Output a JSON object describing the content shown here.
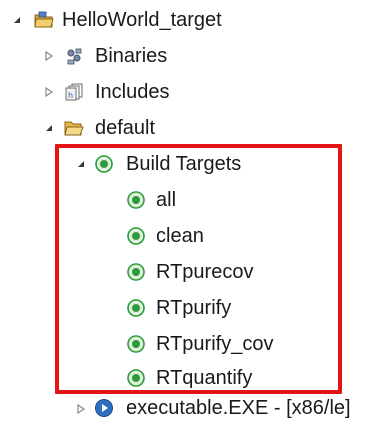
{
  "tree": {
    "project": {
      "label": "HelloWorld_target",
      "expanded": true
    },
    "binaries": {
      "label": "Binaries",
      "expanded": false
    },
    "includes": {
      "label": "Includes",
      "expanded": false
    },
    "default_folder": {
      "label": "default",
      "expanded": true
    },
    "build_targets": {
      "label": "Build Targets",
      "expanded": true,
      "items": [
        "all",
        "clean",
        "RTpurecov",
        "RTpurify",
        "RTpurify_cov",
        "RTquantify"
      ]
    },
    "executable": {
      "label": "executable.EXE - [x86/le]",
      "expanded": false
    }
  },
  "colors": {
    "highlight_border": "#e51414",
    "target_green": "#2e9a3a",
    "folder_yellow": "#e8b54a",
    "exec_blue": "#2f6fbf"
  },
  "icons": {
    "project": "project-folder-icon",
    "binaries": "binaries-icon",
    "includes": "includes-icon",
    "folder": "folder-open-icon",
    "target": "build-target-icon",
    "executable": "executable-icon"
  }
}
